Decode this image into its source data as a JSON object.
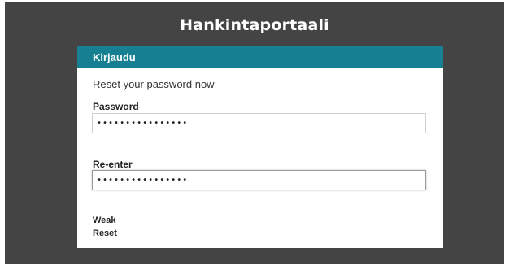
{
  "app": {
    "title": "Hankintaportaali"
  },
  "login_card": {
    "header": "Kirjaudu",
    "subtitle": "Reset your password now",
    "password": {
      "label": "Password",
      "value": "••••••••••••••••"
    },
    "reenter": {
      "label": "Re-enter",
      "value": "••••••••••••••••"
    },
    "strength_text": "Weak",
    "reset_label": "Reset"
  },
  "colors": {
    "background": "#444444",
    "header_bar": "#167f91",
    "card": "#ffffff"
  }
}
